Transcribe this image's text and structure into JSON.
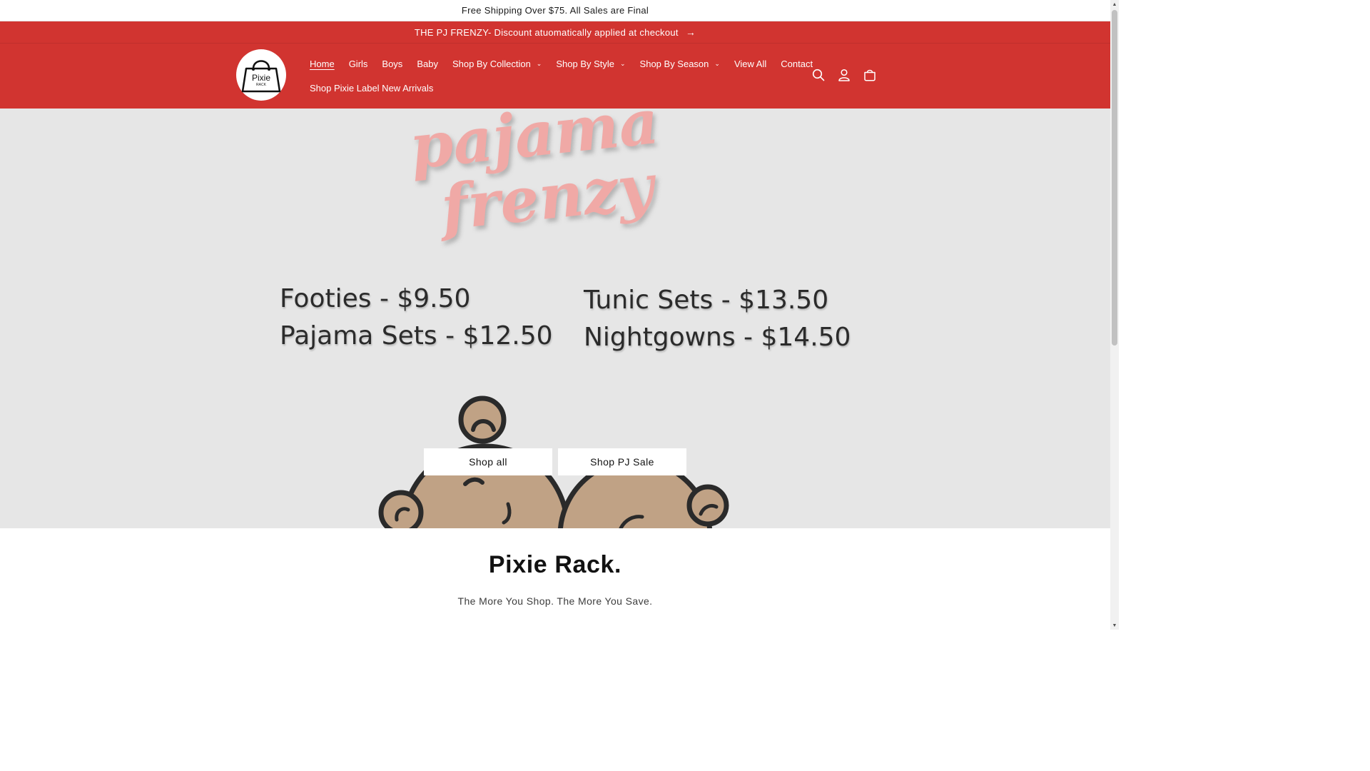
{
  "announcement": {
    "text": "Free Shipping Over $75. All Sales are Final"
  },
  "promo": {
    "text": "THE PJ FRENZY- Discount atuomatically applied at checkout",
    "arrow_icon": "arrow-right-icon"
  },
  "logo": {
    "line1": "Pixie",
    "line2": "RACK"
  },
  "nav": {
    "items": [
      {
        "label": "Home"
      },
      {
        "label": "Girls"
      },
      {
        "label": "Boys"
      },
      {
        "label": "Baby"
      },
      {
        "label": "Shop By Collection"
      },
      {
        "label": "Shop By Style"
      },
      {
        "label": "Shop By Season"
      },
      {
        "label": "View All"
      },
      {
        "label": "Contact"
      },
      {
        "label": "Shop Pixie Label New Arrivals"
      }
    ],
    "active": "Home"
  },
  "header_icons": [
    "search-icon",
    "account-icon",
    "cart-icon"
  ],
  "hero": {
    "script_line1": "pajama",
    "script_line2": "frenzy",
    "prices": [
      "Footies - $9.50",
      "Pajama Sets - $12.50",
      "Tunic Sets - $13.50",
      "Nightgowns - $14.50"
    ],
    "button_shop_all": "Shop all",
    "button_pj_sale": "Shop PJ Sale"
  },
  "brand": {
    "title": "Pixie Rack.",
    "subtitle": "The More You Shop. The More You Save."
  },
  "colors": {
    "brand_red": "#d13430",
    "hero_bg": "#e6e6e6",
    "script_pink": "#f0a9a6",
    "bear_tan": "#c0a285"
  }
}
